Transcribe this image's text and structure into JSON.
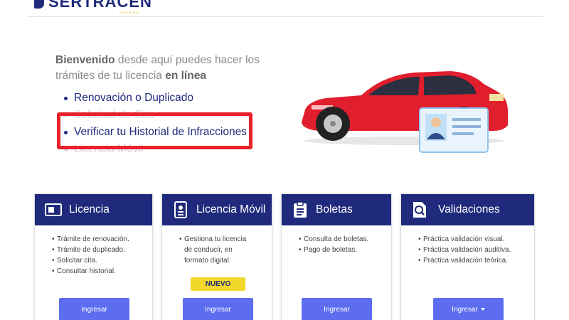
{
  "header": {
    "logo_text": "SERTRACEN",
    "logo_sub": "PANAMÁ"
  },
  "hero": {
    "welcome_bold": "Bienvenido",
    "welcome_text": " desde aquí puedes hacer los trámites de tu licencia ",
    "welcome_bold2": "en línea",
    "links": [
      {
        "label": "Renovación o Duplicado"
      },
      {
        "label": "Solicitud de Cita"
      },
      {
        "label": "Verificar tu Historial de Infracciones"
      },
      {
        "label": "Licencia Móvil"
      }
    ]
  },
  "cards": [
    {
      "title": "Licencia",
      "icon": "license-card-icon",
      "items": [
        "Trámite de renovación.",
        "Trámite de duplicado.",
        "Solicitar cita.",
        "Consultar historial."
      ],
      "button": "Ingresar"
    },
    {
      "title": "Licencia Móvil",
      "icon": "mobile-license-icon",
      "items": [
        "Gestiona tu licencia",
        "de conducir, en",
        "formato digital."
      ],
      "badge": "NUEVO",
      "button": "Ingresar"
    },
    {
      "title": "Boletas",
      "icon": "clipboard-icon",
      "items": [
        "Consulta de boletas.",
        "Pago de boletas."
      ],
      "button": "Ingresar"
    },
    {
      "title": "Validaciones",
      "icon": "search-document-icon",
      "items": [
        "Práctica validación visual.",
        "Práctica validación auditiva.",
        "Práctica validación teórica."
      ],
      "button": "Ingresar"
    }
  ],
  "colors": {
    "brand_navy": "#1f2a7c",
    "button_blue": "#5d6df0",
    "badge_yellow": "#f2d82a",
    "highlight_red": "#e8222a",
    "car_red": "#e01e2d"
  }
}
